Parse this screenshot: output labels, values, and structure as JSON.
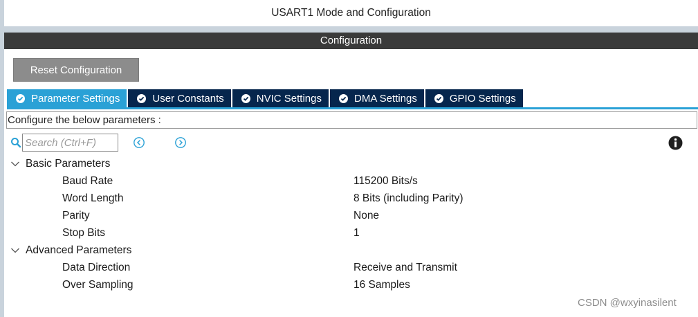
{
  "window": {
    "mode_title": "USART1 Mode and Configuration",
    "section_title": "Configuration"
  },
  "toolbar": {
    "reset_label": "Reset Configuration"
  },
  "tabs": [
    {
      "label": "Parameter Settings",
      "active": true
    },
    {
      "label": "User Constants",
      "active": false
    },
    {
      "label": "NVIC Settings",
      "active": false
    },
    {
      "label": "DMA Settings",
      "active": false
    },
    {
      "label": "GPIO Settings",
      "active": false
    }
  ],
  "configure_text": "Configure the below parameters :",
  "search": {
    "placeholder": "Search (Ctrl+F)",
    "value": ""
  },
  "groups": [
    {
      "title": "Basic Parameters",
      "expanded": true,
      "params": [
        {
          "name": "Baud Rate",
          "value": "115200 Bits/s"
        },
        {
          "name": "Word Length",
          "value": "8 Bits (including Parity)"
        },
        {
          "name": "Parity",
          "value": "None"
        },
        {
          "name": "Stop Bits",
          "value": "1"
        }
      ]
    },
    {
      "title": "Advanced Parameters",
      "expanded": true,
      "params": [
        {
          "name": "Data Direction",
          "value": "Receive and Transmit"
        },
        {
          "name": "Over Sampling",
          "value": "16 Samples"
        }
      ]
    }
  ],
  "watermark": "CSDN @wxyinasilent",
  "colors": {
    "active_tab": "#2aa1d6",
    "inactive_tab": "#06264d",
    "section_bar": "#3a3a3a",
    "reset_button": "#8c8c8c",
    "nav_icon": "#2aa1d6"
  },
  "icons": {
    "tab_status": "check-circle-icon",
    "search": "search-icon",
    "prev": "circle-chevron-left-icon",
    "next": "circle-chevron-right-icon",
    "info": "info-icon",
    "group_toggle": "chevron-down-icon"
  }
}
